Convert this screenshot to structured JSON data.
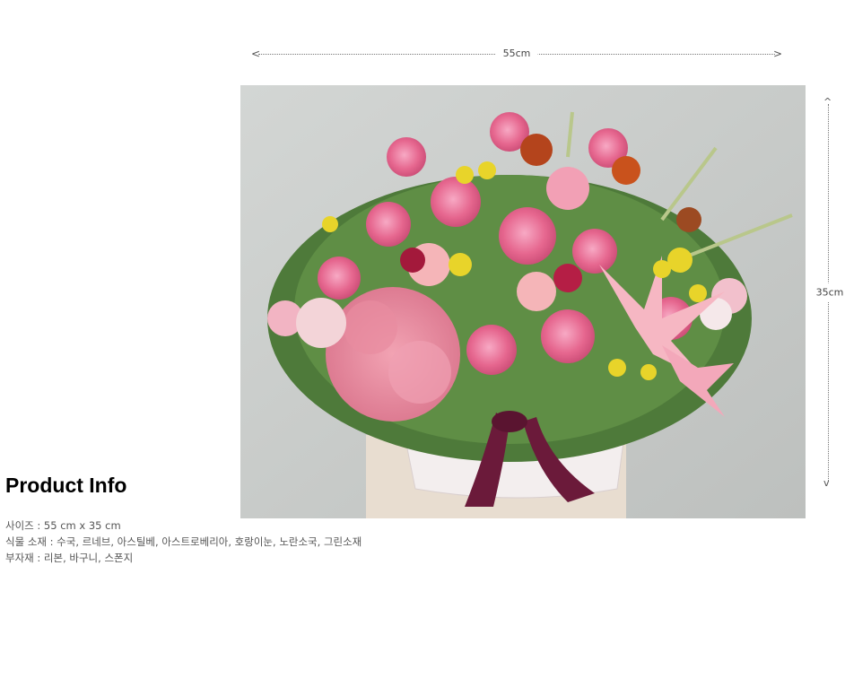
{
  "dimensions": {
    "width_label": "55cm",
    "height_label": "35cm",
    "left_arrow": "<",
    "right_arrow": ">",
    "up_arrow": "^",
    "down_arrow": "v"
  },
  "product_image": {
    "alt": "flower basket",
    "icon": "flower-basket-photo"
  },
  "product_info": {
    "title": "Product Info",
    "size_line": "사이즈 : 55 cm x 35 cm",
    "plant_line": "식물 소재 : 수국, 르네브, 아스틸베, 아스트로베리아, 호랑이눈, 노란소국, 그린소재",
    "accessory_line": "부자재 : 리본, 바구니, 스폰지"
  },
  "colors": {
    "background": "#ffffff",
    "title": "#000000",
    "text": "#555555",
    "photo_backdrop": "#c9ccca"
  }
}
